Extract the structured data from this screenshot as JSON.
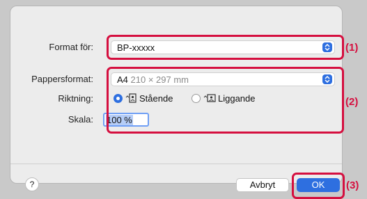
{
  "dialog": {
    "printer": {
      "label": "Format för:",
      "value": "BP-xxxxx"
    },
    "paper": {
      "label": "Pappersformat:",
      "size_name": "A4",
      "size_dims": "210 × 297 mm"
    },
    "orientation": {
      "label": "Riktning:",
      "options": [
        {
          "label": "Stående",
          "selected": true
        },
        {
          "label": "Liggande",
          "selected": false
        }
      ]
    },
    "scale": {
      "label": "Skala:",
      "value": "100 %"
    },
    "buttons": {
      "help": "?",
      "cancel": "Avbryt",
      "ok": "OK"
    }
  },
  "callouts": {
    "c1": "(1)",
    "c2": "(2)",
    "c3": "(3)"
  },
  "colors": {
    "accent": "#2e6fe0",
    "callout": "#d50f3f"
  }
}
